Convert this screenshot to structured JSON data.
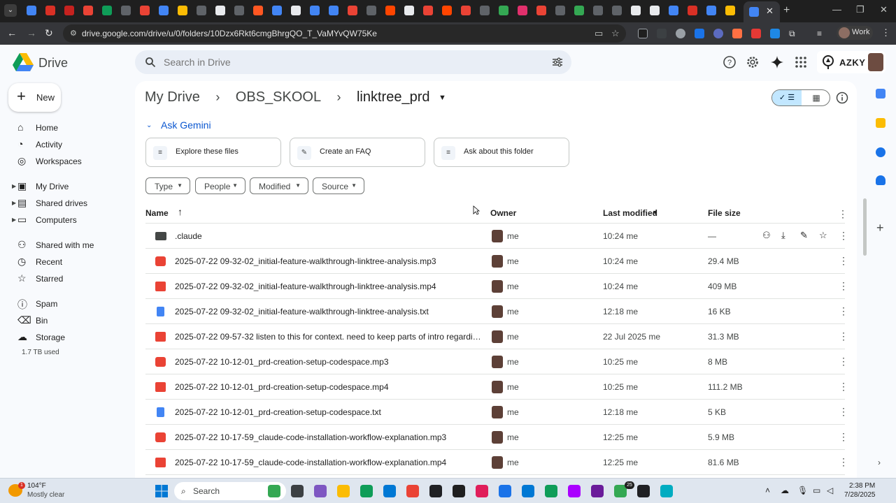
{
  "browser": {
    "url": "drive.google.com/drive/u/0/folders/10Dzx6Rkt6cmgBhrgQO_T_VaMYvQW75Ke",
    "profile_label": "Work",
    "tab_close": "✕",
    "new_tab": "+",
    "menu_icon": "⌄",
    "tab_favicon_colors": [
      "#4285f4",
      "#d93025",
      "#c5221f",
      "#ea4335",
      "#0f9d58",
      "#5f6368",
      "#ea4335",
      "#4285f4",
      "#fbbc04",
      "#5f6368",
      "#e8eaed",
      "#5f6368",
      "#ff5722",
      "#4285f4",
      "#e8eaed",
      "#4285f4",
      "#4285f4",
      "#ea4335",
      "#5f6368",
      "#ff4500",
      "#e8eaed",
      "#ea4335",
      "#ff4500",
      "#ea4335",
      "#5f6368",
      "#34a853",
      "#e1306c",
      "#ea4335",
      "#5f6368",
      "#34a853",
      "#5f6368",
      "#5f6368",
      "#e8eaed",
      "#e8eaed",
      "#4285f4",
      "#d93025",
      "#4285f4",
      "#fbbc04"
    ]
  },
  "drive": {
    "app_name": "Drive",
    "search_placeholder": "Search in Drive",
    "org_name": "AZKY",
    "new_button": "New",
    "storage_used": "1.7 TB used",
    "nav": [
      {
        "label": "Home",
        "icon": "home-icon"
      },
      {
        "label": "Activity",
        "icon": "activity-icon"
      },
      {
        "label": "Workspaces",
        "icon": "workspaces-icon"
      },
      {
        "label": "My Drive",
        "icon": "my-drive-icon"
      },
      {
        "label": "Shared drives",
        "icon": "shared-drives-icon"
      },
      {
        "label": "Computers",
        "icon": "computers-icon"
      },
      {
        "label": "Shared with me",
        "icon": "shared-with-me-icon"
      },
      {
        "label": "Recent",
        "icon": "recent-icon"
      },
      {
        "label": "Starred",
        "icon": "star-icon"
      },
      {
        "label": "Spam",
        "icon": "spam-icon"
      },
      {
        "label": "Bin",
        "icon": "bin-icon"
      },
      {
        "label": "Storage",
        "icon": "storage-icon"
      }
    ]
  },
  "breadcrumb": [
    "My Drive",
    "OBS_SKOOL",
    "linktree_prd"
  ],
  "gemini": {
    "title": "Ask Gemini",
    "cards": [
      "Explore these files",
      "Create an FAQ",
      "Ask about this folder"
    ]
  },
  "filters": [
    "Type",
    "People",
    "Modified",
    "Source"
  ],
  "columns": {
    "name": "Name",
    "owner": "Owner",
    "last_modified": "Last modified",
    "file_size": "File size"
  },
  "files": [
    {
      "name": ".claude",
      "type": "folder",
      "owner": "me",
      "modified": "10:24 me",
      "size": "—"
    },
    {
      "name": "2025-07-22 09-32-02_initial-feature-walkthrough-linktree-analysis.mp3",
      "type": "audio",
      "owner": "me",
      "modified": "10:24 me",
      "size": "29.4 MB"
    },
    {
      "name": "2025-07-22 09-32-02_initial-feature-walkthrough-linktree-analysis.mp4",
      "type": "video",
      "owner": "me",
      "modified": "10:24 me",
      "size": "409 MB"
    },
    {
      "name": "2025-07-22 09-32-02_initial-feature-walkthrough-linktree-analysis.txt",
      "type": "doc",
      "owner": "me",
      "modified": "12:18 me",
      "size": "16 KB"
    },
    {
      "name": "2025-07-22 09-57-32 listen to this for context. need to keep parts of intro regarding w...",
      "type": "video",
      "owner": "me",
      "modified": "22 Jul 2025 me",
      "size": "31.3 MB"
    },
    {
      "name": "2025-07-22 10-12-01_prd-creation-setup-codespace.mp3",
      "type": "audio",
      "owner": "me",
      "modified": "10:25 me",
      "size": "8 MB"
    },
    {
      "name": "2025-07-22 10-12-01_prd-creation-setup-codespace.mp4",
      "type": "video",
      "owner": "me",
      "modified": "10:25 me",
      "size": "111.2 MB"
    },
    {
      "name": "2025-07-22 10-12-01_prd-creation-setup-codespace.txt",
      "type": "doc",
      "owner": "me",
      "modified": "12:18 me",
      "size": "5 KB"
    },
    {
      "name": "2025-07-22 10-17-59_claude-code-installation-workflow-explanation.mp3",
      "type": "audio",
      "owner": "me",
      "modified": "12:25 me",
      "size": "5.9 MB"
    },
    {
      "name": "2025-07-22 10-17-59_claude-code-installation-workflow-explanation.mp4",
      "type": "video",
      "owner": "me",
      "modified": "12:25 me",
      "size": "81.6 MB"
    }
  ],
  "taskbar": {
    "temperature": "104°F",
    "weather": "Mostly clear",
    "weather_badge": "1",
    "search_label": "Search",
    "notification_count": "25",
    "time": "2:38 PM",
    "date": "7/28/2025"
  },
  "colors": {
    "accent": "#0b57d0",
    "selected_view": "#c2e7ff",
    "audio_icon": "#ea4335",
    "video_icon": "#ea4335",
    "doc_icon": "#4285f4",
    "folder_icon": "#444746"
  }
}
